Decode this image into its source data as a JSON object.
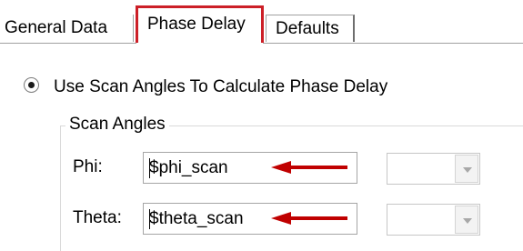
{
  "tabs": [
    {
      "label": "General Data",
      "selected": false
    },
    {
      "label": "Phase Delay",
      "selected": true
    },
    {
      "label": "Defaults",
      "selected": false
    }
  ],
  "radio_option": {
    "label": "Use Scan Angles To Calculate Phase Delay",
    "checked": true
  },
  "scan_angles": {
    "title": "Scan Angles",
    "phi": {
      "label": "Phi:",
      "value": "$phi_scan"
    },
    "theta": {
      "label": "Theta:",
      "value": "$theta_scan"
    }
  },
  "colors": {
    "highlight_border": "#cc1f27",
    "annotation_arrow": "#c00000"
  },
  "icons": {
    "dropdown": "chevron-down-icon",
    "annotation": "arrow-left-icon"
  }
}
